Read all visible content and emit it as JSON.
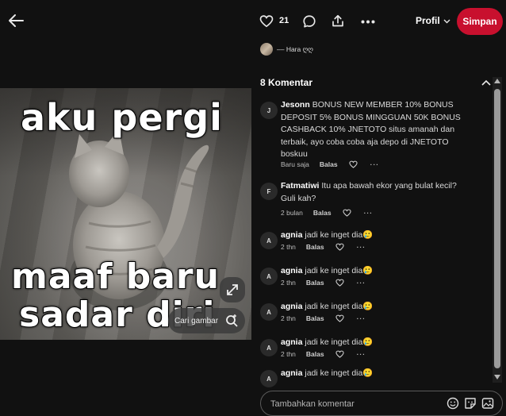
{
  "header": {
    "back_icon": "arrow-left-icon",
    "like_count": "21",
    "profile_label": "Profil",
    "save_label": "Simpan"
  },
  "pin": {
    "author": "‒‒ Hara ღღ",
    "meme_top": "aku pergi",
    "meme_bottom_1": "maaf baru",
    "meme_bottom_2": "sadar diri",
    "search_image_label": "Cari gambar"
  },
  "comments": {
    "title": "8 Komentar",
    "reply_label": "Balas",
    "items": [
      {
        "avatar": "J",
        "user": "Jesonn",
        "text": "BONUS NEW MEMBER 10% BONUS DEPOSIT 5% BONUS MINGGUAN 50K BONUS CASHBACK 10% JNETOTO situs amanah dan terbaik, ayo coba coba aja depo di JNETOTO boskuu",
        "time": "Baru saja"
      },
      {
        "avatar": "F",
        "user": "Fatmatiwi",
        "text": "Itu apa bawah ekor yang bulat kecil? Guli kah?",
        "time": "2 bulan"
      },
      {
        "avatar": "A",
        "user": "agnia",
        "text": "jadi ke inget dia🥲",
        "time": "2 thn"
      },
      {
        "avatar": "A",
        "user": "agnia",
        "text": "jadi ke inget dia🥲",
        "time": "2 thn"
      },
      {
        "avatar": "A",
        "user": "agnia",
        "text": "jadi ke inget dia🥲",
        "time": "2 thn"
      },
      {
        "avatar": "A",
        "user": "agnia",
        "text": "jadi ke inget dia🥲",
        "time": "2 thn"
      },
      {
        "avatar": "A",
        "user": "agnia",
        "text": "jadi ke inget dia🥲",
        "time": ""
      }
    ]
  },
  "composer": {
    "placeholder": "Tambahkan komentar"
  },
  "colors": {
    "background": "#111111",
    "save_button": "#c8102e"
  }
}
